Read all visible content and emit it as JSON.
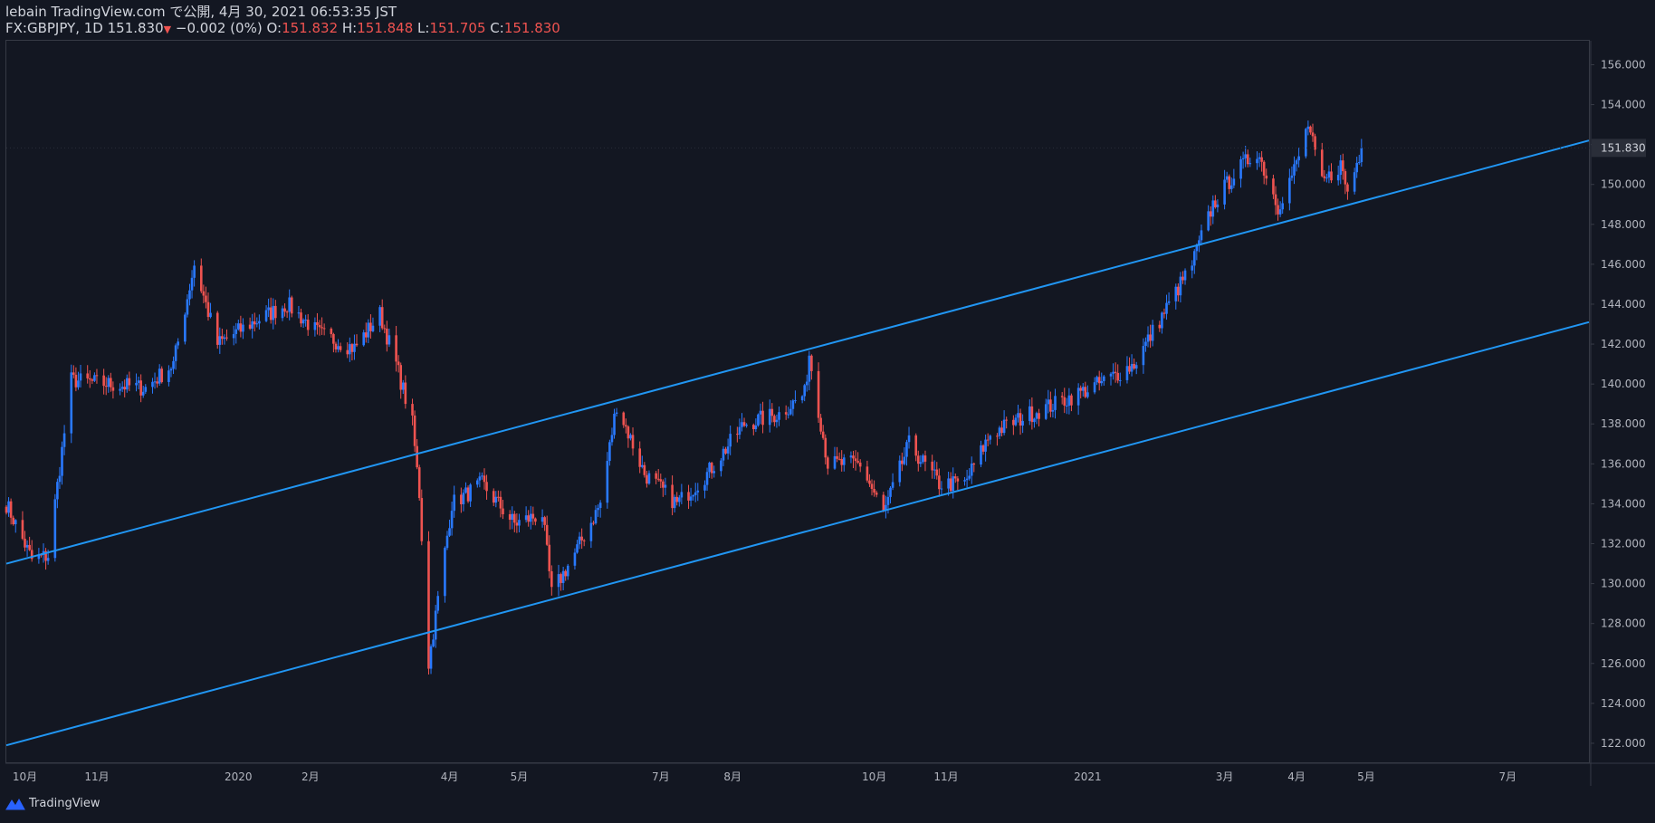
{
  "header": {
    "line1": "lebain TradingView.com で公開, 4月 30, 2021 06:53:35 JST",
    "symbol_line": "FX:GBPJPY, 1D 151.830",
    "change": "−0.002 (0%)",
    "o_label": "O:",
    "o_value": "151.832",
    "h_label": "H:",
    "h_value": "151.848",
    "l_label": "L:",
    "l_value": "151.705",
    "c_label": "C:",
    "c_value": "151.830"
  },
  "footer": {
    "brand": "TradingView"
  },
  "chart_data": {
    "type": "candlestick",
    "symbol": "FX:GBPJPY",
    "interval": "1D",
    "last_price": "151.830",
    "colors": {
      "up": "#2962ff",
      "up_body": "#2979ff",
      "down": "#ef5350",
      "line": "#2196f3",
      "bg": "#131722"
    },
    "y_ticks": [
      "122.000",
      "124.000",
      "126.000",
      "128.000",
      "130.000",
      "132.000",
      "134.000",
      "136.000",
      "138.000",
      "140.000",
      "142.000",
      "144.000",
      "146.000",
      "148.000",
      "150.000",
      "152.000",
      "154.000",
      "156.000"
    ],
    "ylim": [
      121.0,
      157.2
    ],
    "x_labels": [
      "10月",
      "11月",
      "2020",
      "2月",
      "4月",
      "5月",
      "7月",
      "8月",
      "10月",
      "11月",
      "2021",
      "3月",
      "4月",
      "5月",
      "7月"
    ],
    "x_label_dates": [
      "2019-10-01",
      "2019-11-01",
      "2020-01-01",
      "2020-02-01",
      "2020-04-01",
      "2020-05-01",
      "2020-07-01",
      "2020-08-01",
      "2020-10-01",
      "2020-11-01",
      "2021-01-01",
      "2021-03-01",
      "2021-04-01",
      "2021-05-01",
      "2021-07-01"
    ],
    "xlim": [
      "2019-09-23",
      "2021-08-05"
    ],
    "series": [
      {
        "dates": [
          "2019-09-23",
          "2019-10-04",
          "2019-10-11",
          "2019-10-21",
          "2019-11-06",
          "2019-11-22",
          "2019-12-04",
          "2019-12-13",
          "2019-12-23",
          "2020-01-06",
          "2020-01-22",
          "2020-02-05",
          "2020-02-20",
          "2020-03-02",
          "2020-03-09",
          "2020-03-16",
          "2020-03-19",
          "2020-03-23",
          "2020-04-02",
          "2020-04-15",
          "2020-04-29",
          "2020-05-11",
          "2020-05-15",
          "2020-05-25",
          "2020-06-05",
          "2020-06-12",
          "2020-06-24",
          "2020-07-08",
          "2020-07-21",
          "2020-08-06",
          "2020-08-21",
          "2020-09-01",
          "2020-09-03",
          "2020-09-11",
          "2020-09-25",
          "2020-10-05",
          "2020-10-16",
          "2020-10-29",
          "2020-11-09",
          "2020-11-20",
          "2020-12-07",
          "2020-12-18",
          "2021-01-06",
          "2021-01-21",
          "2021-02-05",
          "2021-02-15",
          "2021-02-24",
          "2021-03-05",
          "2021-03-15",
          "2021-03-24",
          "2021-04-01",
          "2021-04-06",
          "2021-04-12",
          "2021-04-20",
          "2021-04-23",
          "2021-04-29"
        ],
        "values": [
          134.0,
          131.2,
          131.4,
          140.2,
          140.0,
          139.8,
          141.0,
          146.0,
          142.0,
          143.0,
          144.0,
          142.5,
          141.8,
          143.5,
          141.0,
          138.0,
          134.5,
          126.0,
          134.0,
          135.0,
          133.0,
          133.5,
          129.5,
          131.5,
          134.0,
          139.0,
          135.5,
          134.0,
          135.5,
          138.0,
          138.5,
          139.5,
          141.5,
          136.0,
          136.0,
          133.5,
          137.0,
          135.0,
          135.0,
          137.5,
          138.5,
          139.0,
          140.0,
          141.0,
          144.0,
          146.0,
          149.0,
          150.5,
          151.7,
          148.9,
          151.0,
          153.0,
          150.0,
          151.0,
          149.6,
          151.83
        ]
      }
    ],
    "trendlines": [
      {
        "name": "upper",
        "points": [
          [
            "2019-09-23",
            131.0
          ],
          [
            "2021-08-05",
            152.2
          ]
        ]
      },
      {
        "name": "lower",
        "points": [
          [
            "2019-09-23",
            121.9
          ],
          [
            "2021-08-05",
            143.1
          ]
        ]
      }
    ]
  }
}
